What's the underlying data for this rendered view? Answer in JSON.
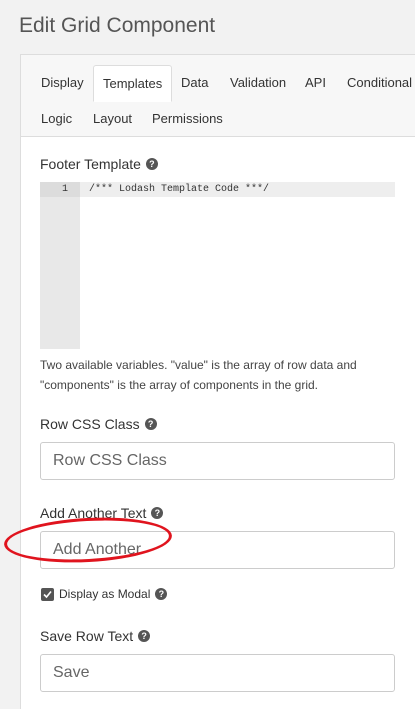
{
  "header": {
    "title": "Edit Grid Component"
  },
  "tabs": [
    {
      "label": "Display"
    },
    {
      "label": "Templates",
      "active": true
    },
    {
      "label": "Data"
    },
    {
      "label": "Validation"
    },
    {
      "label": "API"
    },
    {
      "label": "Conditional"
    },
    {
      "label": "Logic"
    },
    {
      "label": "Layout"
    },
    {
      "label": "Permissions"
    }
  ],
  "footer_template": {
    "label": "Footer Template",
    "line_number": "1",
    "code": "/*** Lodash Template Code ***/",
    "description": "Two available variables. \"value\" is the array of row data and \"components\" is the array of components in the grid."
  },
  "row_css_class": {
    "label": "Row CSS Class",
    "placeholder": "Row CSS Class"
  },
  "add_another_text": {
    "label": "Add Another Text",
    "placeholder": "Add Another"
  },
  "display_as_modal": {
    "label": "Display as Modal",
    "checked": true
  },
  "save_row_text": {
    "label": "Save Row Text",
    "placeholder": "Save"
  },
  "colors": {
    "annotation": "#e0141e",
    "panel_bg": "#ffffff",
    "page_bg": "#f2f2f2"
  }
}
